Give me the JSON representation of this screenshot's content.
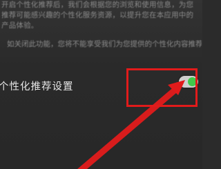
{
  "description": {
    "lines": [
      "开启个性化推荐后，我们会根据您的浏览和使用信息，为您",
      "推荐可能感兴趣的个性化服务资源，以提升您在本应用中的",
      "产品体验。"
    ],
    "off_notice": "如关闭此功能，您将不能享受我们为您提供的个性化内容推荐。"
  },
  "setting": {
    "label": "个性化推荐设置",
    "toggle_state": "on"
  },
  "colors": {
    "background": "#2b2b2b",
    "toggle_on": "#3fc94a",
    "annotation": "#e11b1b"
  },
  "icons": {
    "annotation_arrow": "arrow-icon"
  }
}
